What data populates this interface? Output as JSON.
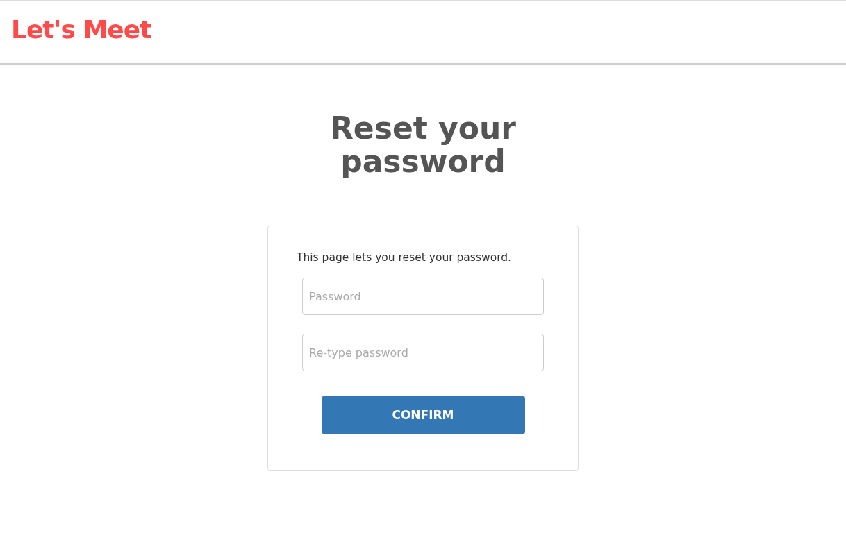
{
  "header": {
    "logo": "Let's Meet"
  },
  "title": "Reset your password",
  "card": {
    "intro": "This page lets you reset your password.",
    "fields": [
      {
        "placeholder": "Password"
      },
      {
        "placeholder": "Re-type password"
      }
    ],
    "button": "CONFIRM"
  }
}
